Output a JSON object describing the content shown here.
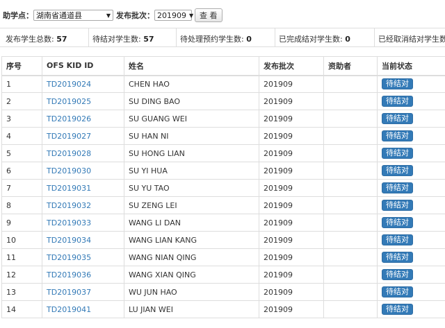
{
  "filters": {
    "site_label": "助学点：",
    "site_value": "湖南省通道县",
    "batch_label": "发布批次：",
    "batch_value": "201909",
    "view_button": "查 看"
  },
  "stats": [
    {
      "label": "发布学生总数:",
      "value": "57"
    },
    {
      "label": "待结对学生数:",
      "value": "57"
    },
    {
      "label": "待处理预约学生数:",
      "value": "0"
    },
    {
      "label": "已完成结对学生数:",
      "value": "0"
    },
    {
      "label": "已经取消结对学生数:",
      "value": ""
    }
  ],
  "table": {
    "headers": [
      "序号",
      "OFS KID ID",
      "姓名",
      "发布批次",
      "资助者",
      "当前状态"
    ],
    "rows": [
      {
        "no": "1",
        "id": "TD2019024",
        "name": "CHEN HAO",
        "batch": "201909",
        "sponsor": "",
        "status": "待结对"
      },
      {
        "no": "2",
        "id": "TD2019025",
        "name": "SU DING BAO",
        "batch": "201909",
        "sponsor": "",
        "status": "待结对"
      },
      {
        "no": "3",
        "id": "TD2019026",
        "name": "SU GUANG WEI",
        "batch": "201909",
        "sponsor": "",
        "status": "待结对"
      },
      {
        "no": "4",
        "id": "TD2019027",
        "name": "SU HAN NI",
        "batch": "201909",
        "sponsor": "",
        "status": "待结对"
      },
      {
        "no": "5",
        "id": "TD2019028",
        "name": "SU HONG LIAN",
        "batch": "201909",
        "sponsor": "",
        "status": "待结对"
      },
      {
        "no": "6",
        "id": "TD2019030",
        "name": "SU YI HUA",
        "batch": "201909",
        "sponsor": "",
        "status": "待结对"
      },
      {
        "no": "7",
        "id": "TD2019031",
        "name": "SU YU TAO",
        "batch": "201909",
        "sponsor": "",
        "status": "待结对"
      },
      {
        "no": "8",
        "id": "TD2019032",
        "name": "SU ZENG LEI",
        "batch": "201909",
        "sponsor": "",
        "status": "待结对"
      },
      {
        "no": "9",
        "id": "TD2019033",
        "name": "WANG LI DAN",
        "batch": "201909",
        "sponsor": "",
        "status": "待结对"
      },
      {
        "no": "10",
        "id": "TD2019034",
        "name": "WANG LIAN KANG",
        "batch": "201909",
        "sponsor": "",
        "status": "待结对"
      },
      {
        "no": "11",
        "id": "TD2019035",
        "name": "WANG NIAN QING",
        "batch": "201909",
        "sponsor": "",
        "status": "待结对"
      },
      {
        "no": "12",
        "id": "TD2019036",
        "name": "WANG XIAN QING",
        "batch": "201909",
        "sponsor": "",
        "status": "待结对"
      },
      {
        "no": "13",
        "id": "TD2019037",
        "name": "WU JUN HAO",
        "batch": "201909",
        "sponsor": "",
        "status": "待结对"
      },
      {
        "no": "14",
        "id": "TD2019041",
        "name": "LU JIAN WEI",
        "batch": "201909",
        "sponsor": "",
        "status": "待结对"
      }
    ]
  }
}
